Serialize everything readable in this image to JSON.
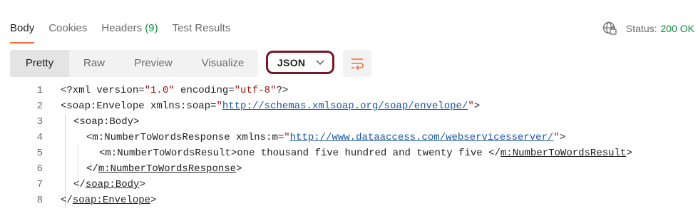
{
  "tabs": [
    {
      "label": "Body"
    },
    {
      "label": "Cookies"
    },
    {
      "label": "Headers",
      "count": "(9)"
    },
    {
      "label": "Test Results"
    }
  ],
  "status": {
    "label": "Status:",
    "value": "200 OK",
    "icon": "globe-icon"
  },
  "view_modes": [
    "Pretty",
    "Raw",
    "Preview",
    "Visualize"
  ],
  "selected_view": "Pretty",
  "format": {
    "selected": "JSON",
    "highlight_color": "#7b1626"
  },
  "wrap_icon": "wrap-lines-icon",
  "accent_color": "#ff6c37",
  "code": {
    "line_numbers": [
      "1",
      "2",
      "3",
      "4",
      "5",
      "6",
      "7",
      "8"
    ],
    "l1": {
      "a": "<?xml version=",
      "b": "\"1.0\"",
      "c": " encoding=",
      "d": "\"utf-8\"",
      "e": "?>"
    },
    "l2": {
      "a": "<soap:Envelope xmlns:soap=",
      "q1": "\"",
      "url": "http://schemas.xmlsoap.org/soap/envelope/",
      "q2": "\"",
      "e": ">"
    },
    "l3": {
      "a": "<soap:Body>"
    },
    "l4": {
      "a": "<m:NumberToWordsResponse xmlns:m=",
      "q1": "\"",
      "url": "http://www.dataaccess.com/webservicesserver/",
      "q2": "\"",
      "e": ">"
    },
    "l5": {
      "a": "<m:NumberToWordsResult>",
      "text": "one thousand five hundred and twenty five ",
      "b": "</",
      "tag": "m:NumberToWordsResult",
      "e": ">"
    },
    "l6": {
      "a": "</",
      "tag": "m:NumberToWordsResponse",
      "e": ">"
    },
    "l7": {
      "a": "</",
      "tag": "soap:Body",
      "e": ">"
    },
    "l8": {
      "a": "</",
      "tag": "soap:Envelope",
      "e": ">"
    }
  }
}
